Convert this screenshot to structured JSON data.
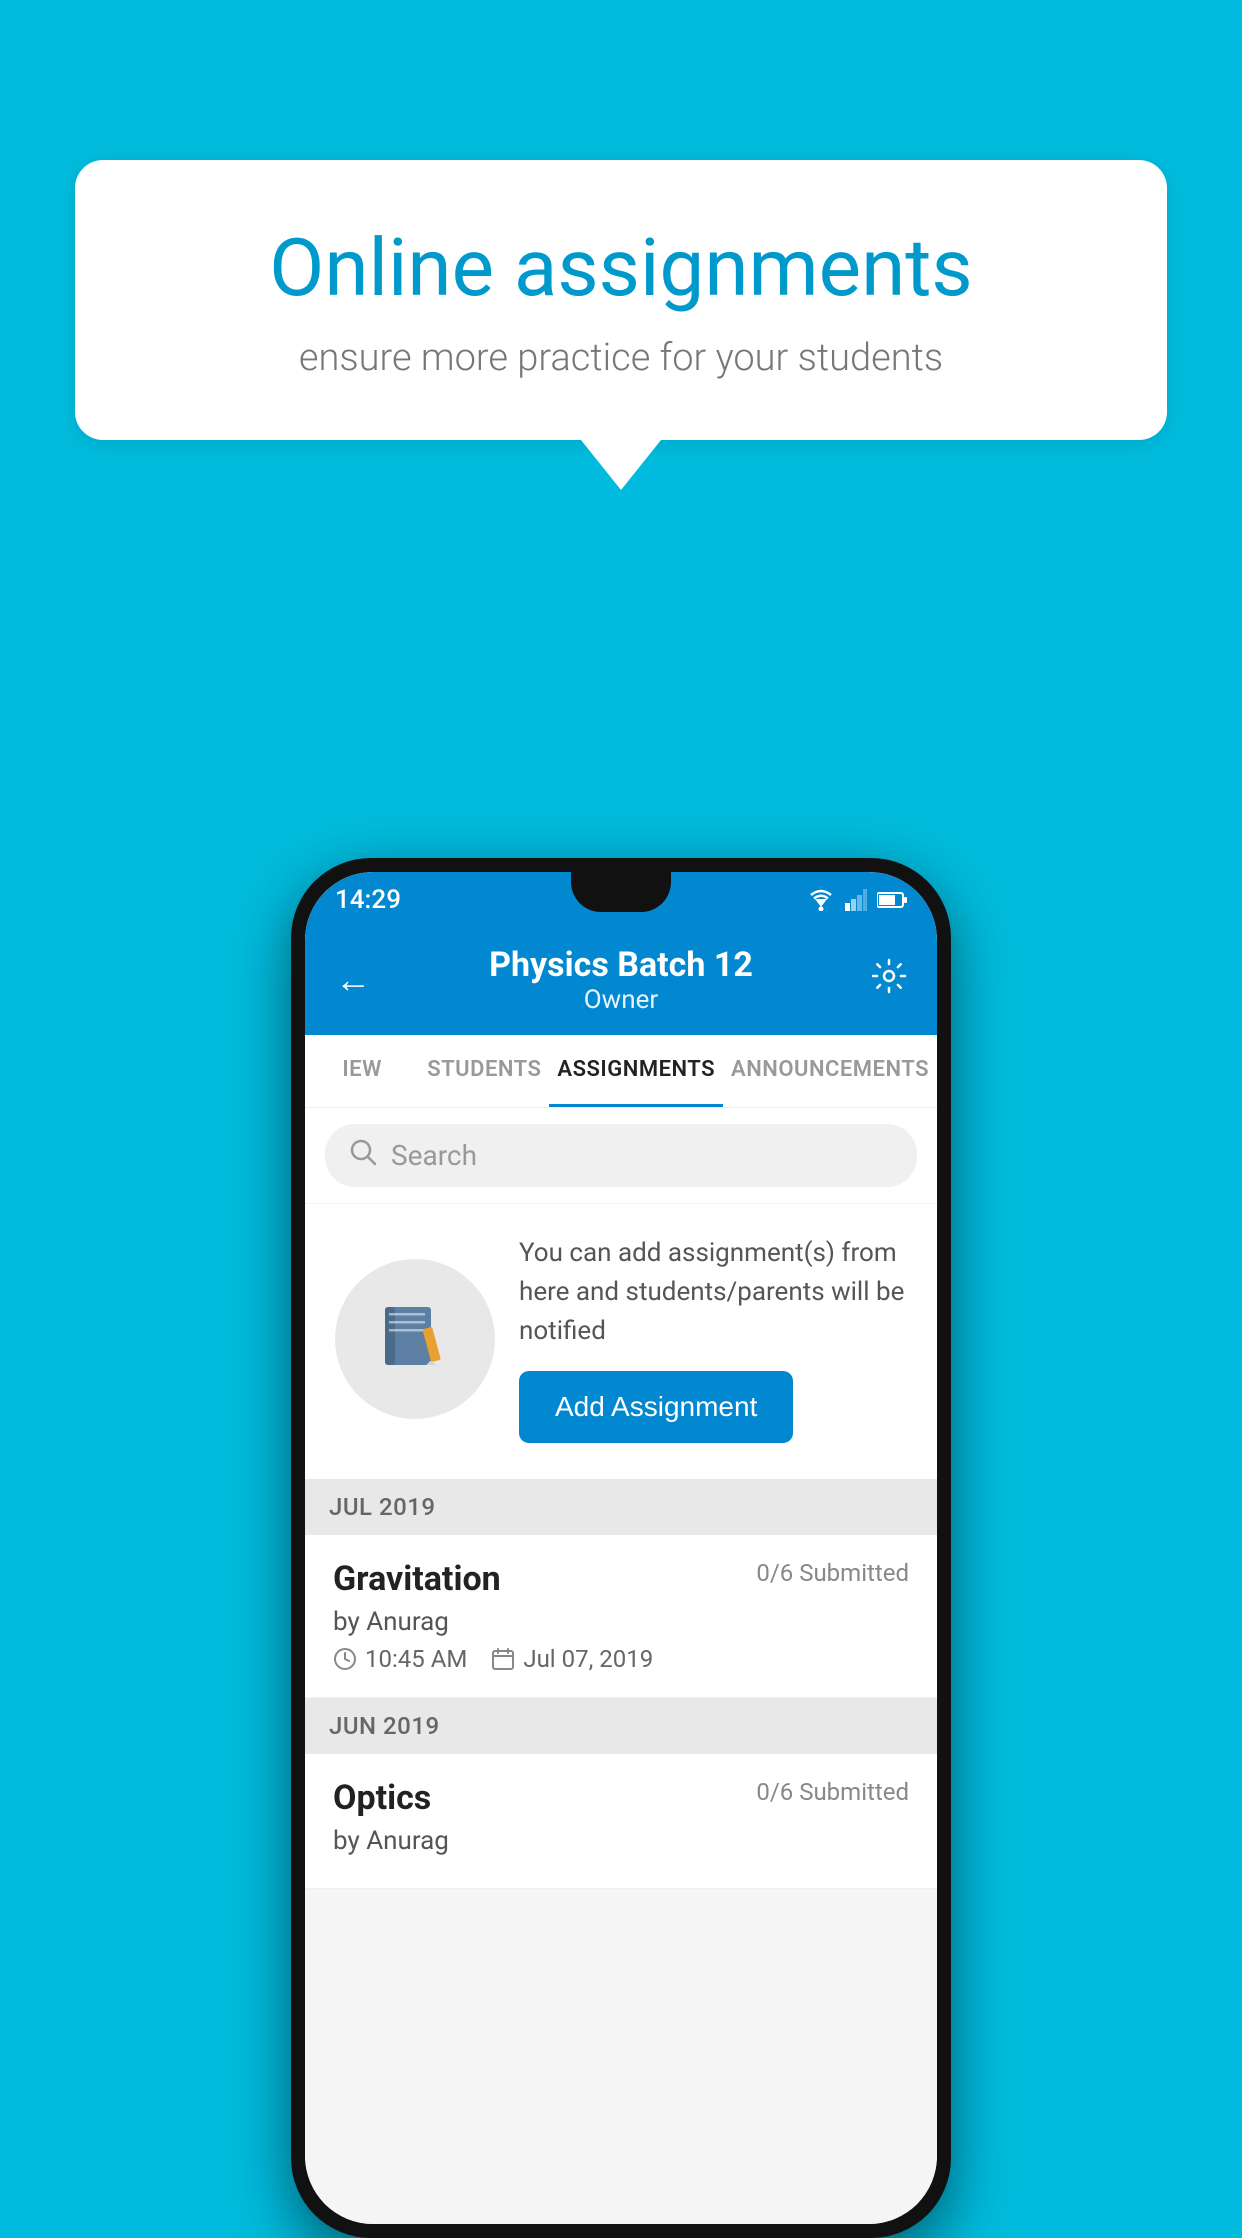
{
  "background_color": "#00BBDD",
  "speech_bubble": {
    "title": "Online assignments",
    "subtitle": "ensure more practice for your students"
  },
  "phone": {
    "status_bar": {
      "time": "14:29"
    },
    "header": {
      "title": "Physics Batch 12",
      "subtitle": "Owner",
      "back_label": "←",
      "settings_label": "⚙"
    },
    "tabs": [
      {
        "label": "IEW",
        "active": false
      },
      {
        "label": "STUDENTS",
        "active": false
      },
      {
        "label": "ASSIGNMENTS",
        "active": true
      },
      {
        "label": "ANNOUNCEMENTS",
        "active": false
      }
    ],
    "search": {
      "placeholder": "Search"
    },
    "add_assignment_section": {
      "info_text": "You can add assignment(s) from here and students/parents will be notified",
      "button_label": "Add Assignment"
    },
    "assignment_groups": [
      {
        "month": "JUL 2019",
        "assignments": [
          {
            "name": "Gravitation",
            "submitted": "0/6 Submitted",
            "by": "by Anurag",
            "time": "10:45 AM",
            "date": "Jul 07, 2019"
          }
        ]
      },
      {
        "month": "JUN 2019",
        "assignments": [
          {
            "name": "Optics",
            "submitted": "0/6 Submitted",
            "by": "by Anurag",
            "time": "",
            "date": ""
          }
        ]
      }
    ]
  }
}
